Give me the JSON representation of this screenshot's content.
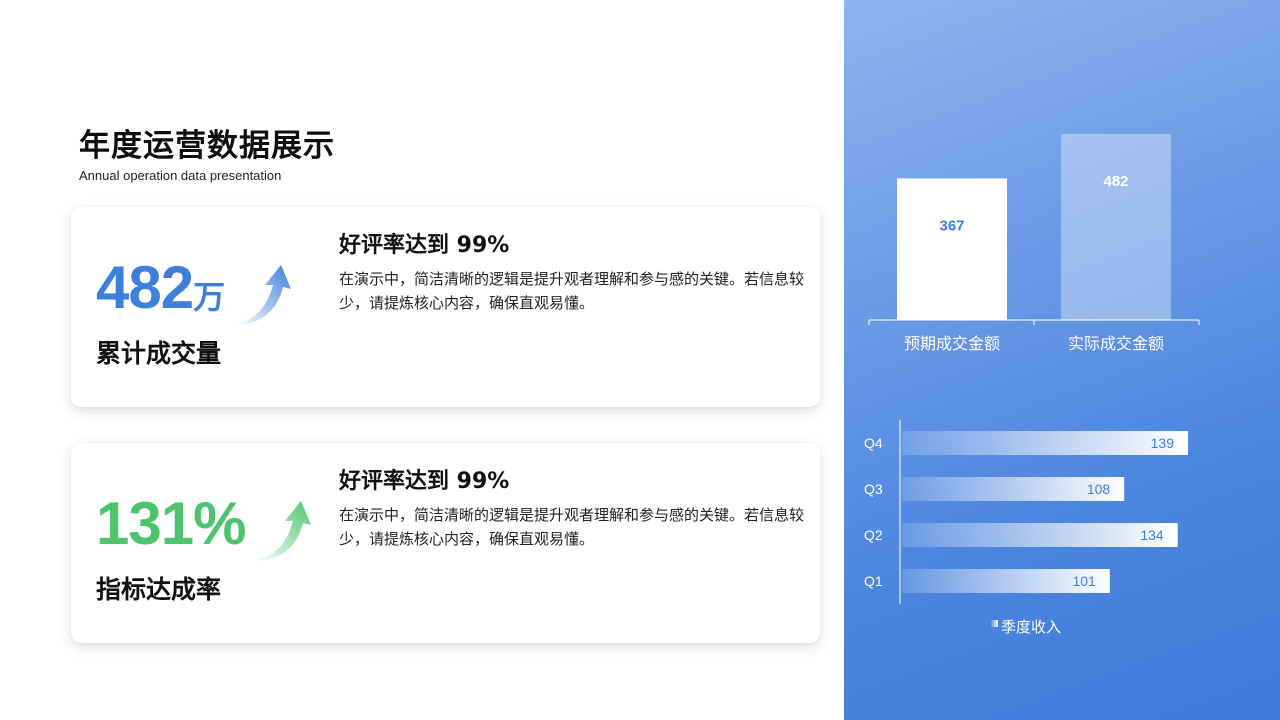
{
  "header": {
    "title": "年度运营数据展示",
    "subtitle": "Annual operation data presentation"
  },
  "cards": [
    {
      "value": "482",
      "unit": "万",
      "label": "累计成交量",
      "heading": "好评率达到 99%",
      "body": "在演示中，简洁清晰的逻辑是提升观者理解和参与感的关键。若信息较少，请提炼核心内容，确保直观易懂。",
      "accent": "#3f7fdc",
      "icon": "trend-up-arrow-icon"
    },
    {
      "value": "131%",
      "unit": "",
      "label": "指标达成率",
      "heading": "好评率达到 99%",
      "body": "在演示中，简洁清晰的逻辑是提升观者理解和参与感的关键。若信息较少，请提炼核心内容，确保直观易懂。",
      "accent": "#4cc36c",
      "icon": "trend-up-arrow-icon"
    }
  ],
  "colors": {
    "panel_gradient_start": "#8fb3ee",
    "panel_gradient_end": "#3f7bdb",
    "bar_label_blue": "#3f7fdc"
  },
  "chart_data": [
    {
      "type": "bar",
      "categories": [
        "预期成交金额",
        "实际成交金额"
      ],
      "values": [
        367,
        482
      ],
      "ylim": [
        0,
        482
      ],
      "grid": false,
      "legend": "none"
    },
    {
      "type": "bar",
      "orientation": "horizontal",
      "categories": [
        "Q1",
        "Q2",
        "Q3",
        "Q4"
      ],
      "series": [
        {
          "name": "季度收入",
          "values": [
            101,
            134,
            108,
            139
          ]
        }
      ],
      "xlim": [
        0,
        139
      ],
      "grid": false,
      "legend": "bottom"
    }
  ]
}
